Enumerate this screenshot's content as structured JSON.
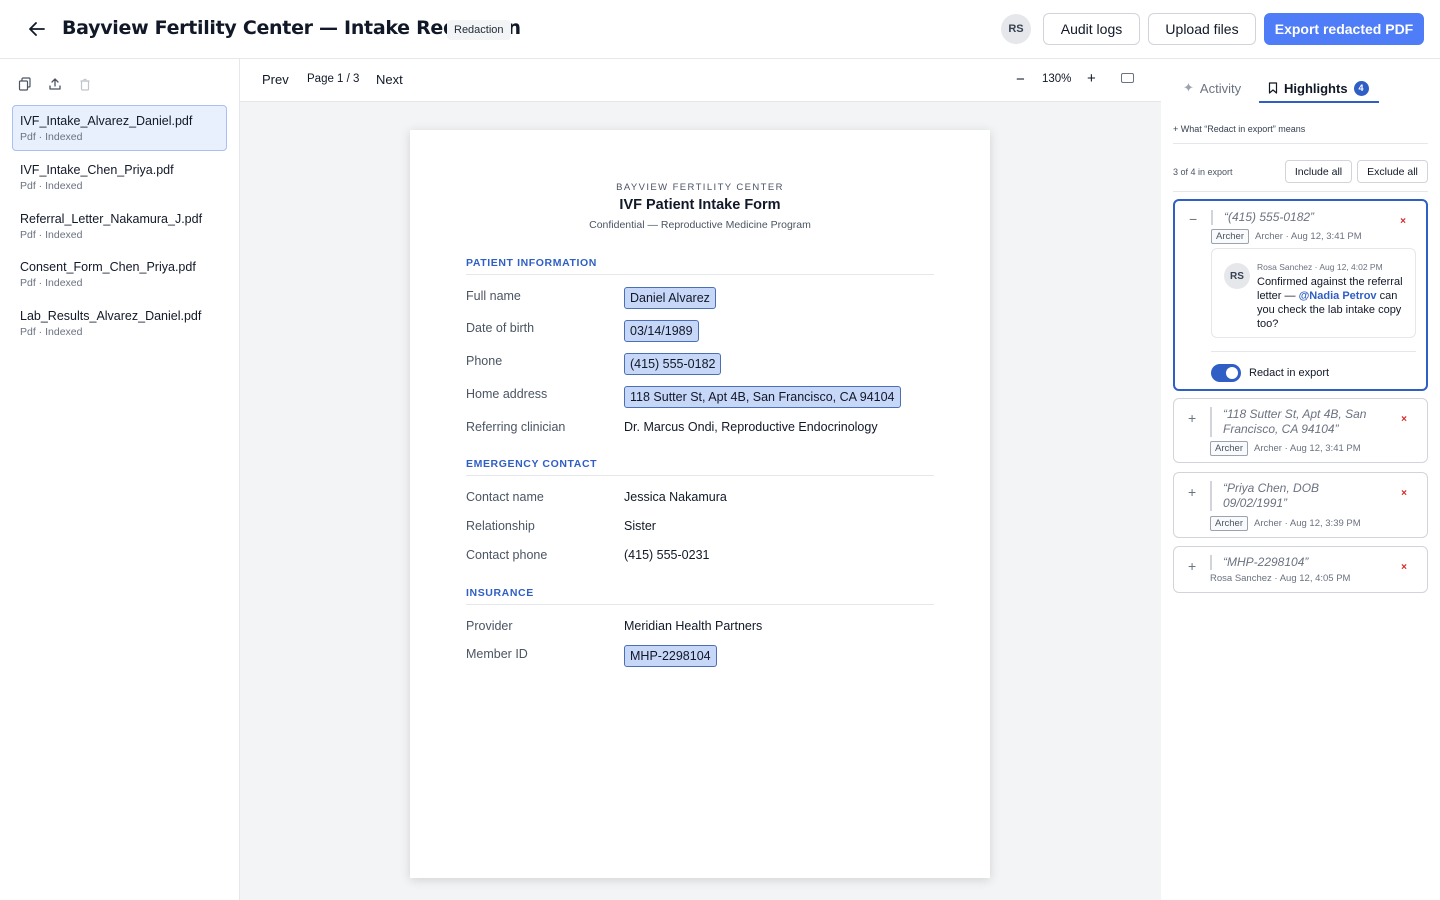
{
  "header": {
    "title": "Bayview Fertility Center — Intake Redaction",
    "badge": "Redaction",
    "user_initials": "RS",
    "audit_label": "Audit logs",
    "upload_label": "Upload files",
    "export_label": "Export redacted PDF",
    "accent": "#4f7cf7"
  },
  "sidebar": {
    "files": [
      {
        "name": "IVF_Intake_Alvarez_Daniel.pdf",
        "meta": "Pdf · Indexed",
        "active": true
      },
      {
        "name": "IVF_Intake_Chen_Priya.pdf",
        "meta": "Pdf · Indexed"
      },
      {
        "name": "Referral_Letter_Nakamura_J.pdf",
        "meta": "Pdf · Indexed"
      },
      {
        "name": "Consent_Form_Chen_Priya.pdf",
        "meta": "Pdf · Indexed"
      },
      {
        "name": "Lab_Results_Alvarez_Daniel.pdf",
        "meta": "Pdf · Indexed"
      }
    ]
  },
  "viewer": {
    "prev_label": "Prev",
    "page_indicator": "Page 1 / 3",
    "next_label": "Next",
    "zoom_minus": "−",
    "zoom_level": "130%",
    "zoom_plus": "+"
  },
  "document": {
    "org": "BAYVIEW FERTILITY CENTER",
    "title": "IVF Patient Intake Form",
    "subtitle": "Confidential — Reproductive Medicine Program",
    "sections": [
      {
        "heading": "PATIENT INFORMATION",
        "fields": [
          {
            "label": "Full name",
            "value": "Daniel Alvarez",
            "highlighted": true
          },
          {
            "label": "Date of birth",
            "value": "03/14/1989",
            "highlighted": true
          },
          {
            "label": "Phone",
            "value": "(415) 555-0182",
            "highlighted": true
          },
          {
            "label": "Home address",
            "value": "118 Sutter St, Apt 4B, San Francisco, CA 94104",
            "highlighted": true
          },
          {
            "label": "Referring clinician",
            "value": "Dr. Marcus Ondi, Reproductive Endocrinology",
            "highlighted": false
          }
        ]
      },
      {
        "heading": "EMERGENCY CONTACT",
        "fields": [
          {
            "label": "Contact name",
            "value": "Jessica Nakamura",
            "highlighted": false
          },
          {
            "label": "Relationship",
            "value": "Sister",
            "highlighted": false
          },
          {
            "label": "Contact phone",
            "value": "(415) 555-0231",
            "highlighted": false
          }
        ]
      },
      {
        "heading": "INSURANCE",
        "fields": [
          {
            "label": "Provider",
            "value": "Meridian Health Partners",
            "highlighted": false
          },
          {
            "label": "Member ID",
            "value": "MHP-2298104",
            "highlighted": true
          }
        ]
      }
    ]
  },
  "panel": {
    "tab_activity": "Activity",
    "tab_highlights": "Highlights",
    "highlights_count": "4",
    "explain_link": "+ What “Redact in export” means",
    "export_count": "3 of 4 in export",
    "include_all": "Include all",
    "exclude_all": "Exclude all",
    "highlights": [
      {
        "toggle": "−",
        "quote": "“(415) 555-0182”",
        "tag": "Archer",
        "meta": "Archer · Aug 12, 3:41 PM",
        "comment": {
          "initials": "RS",
          "meta": "Rosa Sanchez · Aug 12, 4:02 PM",
          "text_before": "Confirmed against the referral letter — ",
          "mention": "@Nadia Petrov",
          "text_after": " can you check the lab intake copy too?"
        },
        "redact_label": "Redact in export",
        "redact_enabled": true
      },
      {
        "toggle": "+",
        "quote": "“118 Sutter St, Apt 4B, San Francisco, CA 94104”",
        "tag": "Archer",
        "meta": "Archer · Aug 12, 3:41 PM"
      },
      {
        "toggle": "+",
        "quote": "“Priya Chen, DOB 09/02/1991”",
        "tag": "Archer",
        "meta": "Archer · Aug 12, 3:39 PM"
      },
      {
        "toggle": "+",
        "quote": "“MHP-2298104”",
        "meta": "Rosa Sanchez · Aug 12, 4:05 PM"
      }
    ],
    "remove_glyph": "×"
  }
}
